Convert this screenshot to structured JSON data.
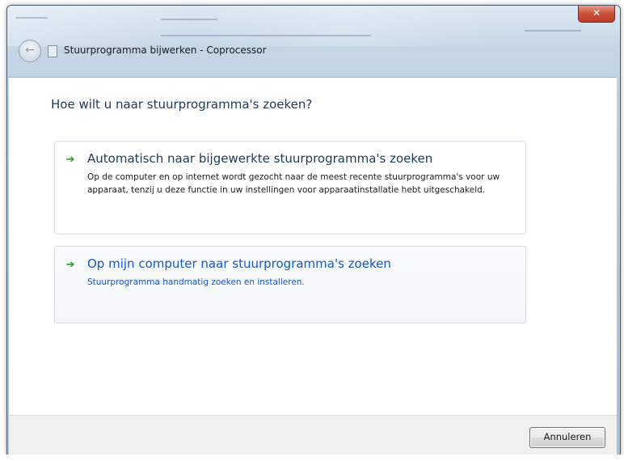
{
  "window": {
    "title": "Stuurprogramma bijwerken - Coprocessor",
    "close_label": "✕"
  },
  "page": {
    "heading": "Hoe wilt u naar stuurprogramma's zoeken?"
  },
  "options": [
    {
      "title": "Automatisch naar bijgewerkte stuurprogramma's zoeken",
      "description": "Op de computer en op internet wordt gezocht naar de meest recente stuurprogramma's voor uw apparaat, tenzij u deze functie in uw instellingen voor apparaatinstallatie hebt uitgeschakeld."
    },
    {
      "title": "Op mijn computer naar stuurprogramma's zoeken",
      "description": "Stuurprogramma handmatig zoeken en installeren."
    }
  ],
  "footer": {
    "cancel_label": "Annuleren"
  },
  "icons": {
    "back": "back-arrow-icon",
    "device": "device-icon",
    "option_arrow": "green-arrow-icon"
  },
  "colors": {
    "heading": "#1e395b",
    "link": "#1656c8",
    "arrow": "#2c9a2c",
    "close": "#c9503a"
  }
}
